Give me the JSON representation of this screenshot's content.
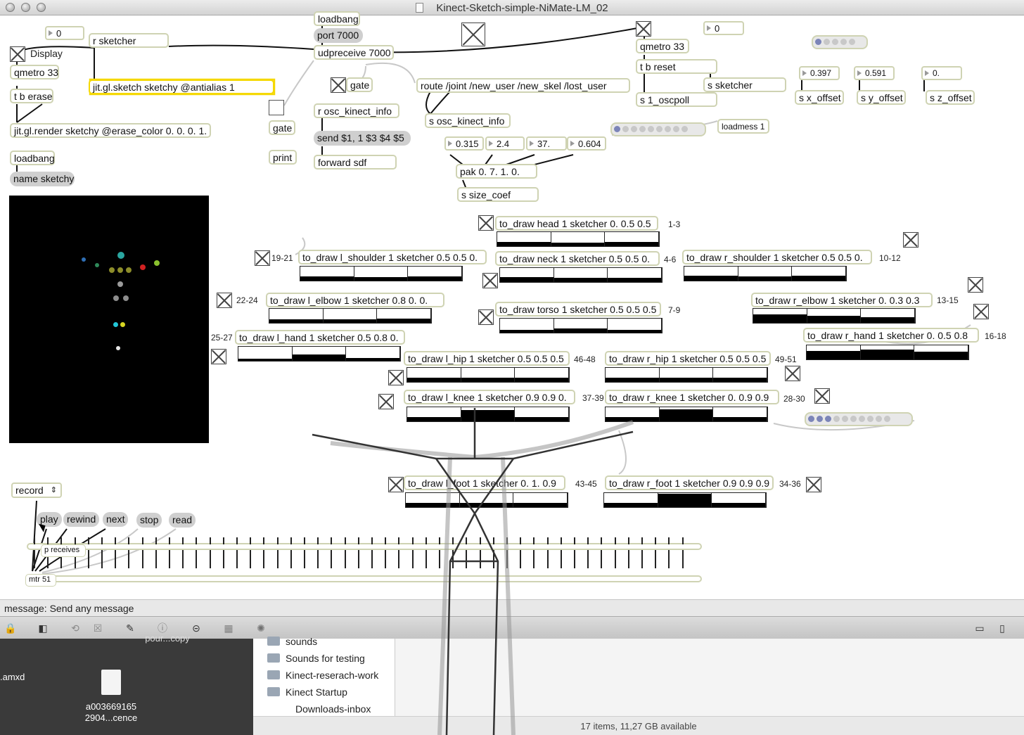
{
  "window": {
    "title": "Kinect-Sketch-simple-NiMate-LM_02"
  },
  "patch": {
    "num_0a": "0",
    "r_sketcher": "r sketcher",
    "display_label": "Display",
    "qmetro_left": "qmetro 33",
    "t_b_erase": "t b erase",
    "jit_gl_sketch": "jit.gl.sketch sketchy @antialias 1",
    "jit_gl_render": "jit.gl.render sketchy @erase_color 0. 0. 0. 1.",
    "loadbang_left": "loadbang",
    "name_sketchy": "name sketchy",
    "loadbang_top": "loadbang",
    "port": "port 7000",
    "udpreceive": "udpreceive 7000",
    "gate1": "gate",
    "gate2": "gate",
    "print": "print",
    "r_osc": "r osc_kinect_info",
    "send_msg": "send $1, 1 $3 $4 $5",
    "forward": "forward sdf",
    "route": "route /joint /new_user /new_skel /lost_user",
    "s_osc": "s osc_kinect_info",
    "qmetro_right": "qmetro 33",
    "num_0b": "0",
    "t_b_reset": "t b reset",
    "s_sketcher": "s sketcher",
    "s_oscpoll": "s 1_oscpoll",
    "x_val": "0.397",
    "y_val": "0.591",
    "z_val": "0.",
    "s_x": "s x_offset",
    "s_y": "s y_offset",
    "s_z": "s z_offset",
    "loadmess": "loadmess 1",
    "nums": [
      "0.315",
      "2.4",
      "37.",
      "0.604"
    ],
    "pak": "pak 0. 7. 1. 0.",
    "s_size": "s size_coef",
    "record": "record",
    "transport": [
      "play",
      "rewind",
      "next",
      "stop",
      "read"
    ],
    "p_receives": "p receives",
    "mtr": "mtr 51"
  },
  "joints": [
    {
      "label": "to_draw head 1 sketcher 0. 0.5 0.5",
      "range": "1-3",
      "levels": [
        0.3,
        0.25,
        0.28
      ]
    },
    {
      "label": "to_draw l_shoulder 1 sketcher 0.5 0.5 0.",
      "range": "19-21",
      "levels": [
        0.3,
        0.25,
        0.3
      ]
    },
    {
      "label": "to_draw neck 1 sketcher 0.5 0.5 0.",
      "range": "4-6",
      "levels": [
        0.35,
        0.3,
        0.32
      ]
    },
    {
      "label": "to_draw r_shoulder 1 sketcher 0.5 0.5 0.",
      "range": "10-12",
      "levels": [
        0.35,
        0.3,
        0.35
      ]
    },
    {
      "label": "to_draw l_elbow 1 sketcher 0.8 0. 0.",
      "range": "22-24",
      "levels": [
        0.25,
        0.25,
        0.3
      ]
    },
    {
      "label": "to_draw torso 1 sketcher 0.5 0.5 0.5",
      "range": "7-9",
      "levels": [
        0.2,
        0.3,
        0.22
      ]
    },
    {
      "label": "to_draw r_elbow 1 sketcher 0. 0.3 0.3",
      "range": "13-15",
      "levels": [
        0.6,
        0.5,
        0.4
      ]
    },
    {
      "label": "to_draw r_hand 1 sketcher 0. 0.5 0.8",
      "range": "16-18",
      "levels": [
        0.6,
        0.7,
        0.55
      ]
    },
    {
      "label": "to_draw l_hand 1 sketcher 0.5 0.8 0.",
      "range": "25-27",
      "levels": [
        0.15,
        0.45,
        0.2
      ]
    },
    {
      "label": "to_draw l_hip 1 sketcher 0.5 0.5 0.5",
      "range": "46-48",
      "levels": [
        0.3,
        0.3,
        0.3
      ]
    },
    {
      "label": "to_draw r_hip 1 sketcher 0.5 0.5 0.5",
      "range": "49-51",
      "levels": [
        0.3,
        0.3,
        0.3
      ]
    },
    {
      "label": "to_draw l_knee 1 sketcher 0.9 0.9 0.",
      "range": "37-39",
      "levels": [
        0.3,
        0.8,
        0.3
      ]
    },
    {
      "label": "to_draw r_knee 1 sketcher 0. 0.9 0.9",
      "range": "28-30",
      "levels": [
        0.3,
        0.85,
        0.3
      ]
    },
    {
      "label": "to_draw l_foot 1 sketcher 0. 1. 0.9",
      "range": "43-45",
      "levels": [
        0.3,
        0.3,
        0.3
      ]
    },
    {
      "label": "to_draw r_foot 1 sketcher 0.9 0.9 0.9",
      "range": "34-36",
      "levels": [
        0.3,
        0.95,
        0.3
      ]
    }
  ],
  "status": {
    "message": "message: Send any message"
  },
  "toolbar": {
    "icons": [
      "lock-icon",
      "presentation-icon",
      "patch-cord-icon",
      "inspector-icon",
      "edit-icon",
      "info-icon",
      "snap-icon",
      "grid-icon",
      "bulb-icon"
    ]
  },
  "finder": {
    "folders": [
      "sounds",
      "Sounds for testing",
      "Kinect-reserach-work",
      "Kinect Startup",
      "Downloads-inbox"
    ],
    "status": "17 items, 11,27 GB available"
  },
  "desktop": {
    "partial_label": "pour...copy",
    "file_left": ".amxd",
    "file_name_1": "a003669165",
    "file_name_2": "2904...cence"
  },
  "colors": {
    "border": "#cfd3b3",
    "message_bg": "#cfcfcf",
    "selected_outline": "#f5d800"
  }
}
